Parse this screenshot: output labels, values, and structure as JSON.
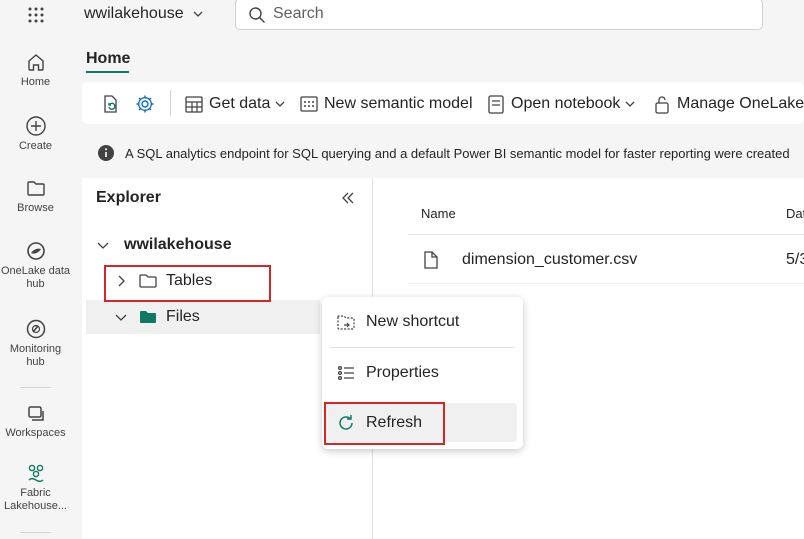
{
  "topbar": {
    "workspace_name": "wwilakehouse",
    "search_placeholder": "Search"
  },
  "rail": {
    "items": [
      {
        "label": "Home",
        "icon": "home-icon"
      },
      {
        "label": "Create",
        "icon": "plus-circle-icon"
      },
      {
        "label": "Browse",
        "icon": "folder-icon"
      },
      {
        "label": "OneLake data hub",
        "icon": "onelake-icon"
      },
      {
        "label": "Monitoring hub",
        "icon": "monitor-icon"
      },
      {
        "label": "Workspaces",
        "icon": "workspaces-icon"
      },
      {
        "label": "Fabric Lakehouse...",
        "icon": "lakehouse-icon"
      }
    ]
  },
  "ribbon": {
    "tab": "Home",
    "get_data": "Get data",
    "new_semantic_model": "New semantic model",
    "open_notebook": "Open notebook",
    "manage_onelake": "Manage OneLake d"
  },
  "info": {
    "message": "A SQL analytics endpoint for SQL querying and a default Power BI semantic model for faster reporting were created"
  },
  "explorer": {
    "title": "Explorer",
    "root": "wwilakehouse",
    "tables": "Tables",
    "files": "Files"
  },
  "list": {
    "col_name": "Name",
    "col_date": "Dat",
    "rows": [
      {
        "name": "dimension_customer.csv",
        "date": "5/3"
      }
    ]
  },
  "context_menu": {
    "new_shortcut": "New shortcut",
    "properties": "Properties",
    "refresh": "Refresh"
  },
  "colors": {
    "accent": "#117865",
    "highlight_box": "#d62728"
  }
}
